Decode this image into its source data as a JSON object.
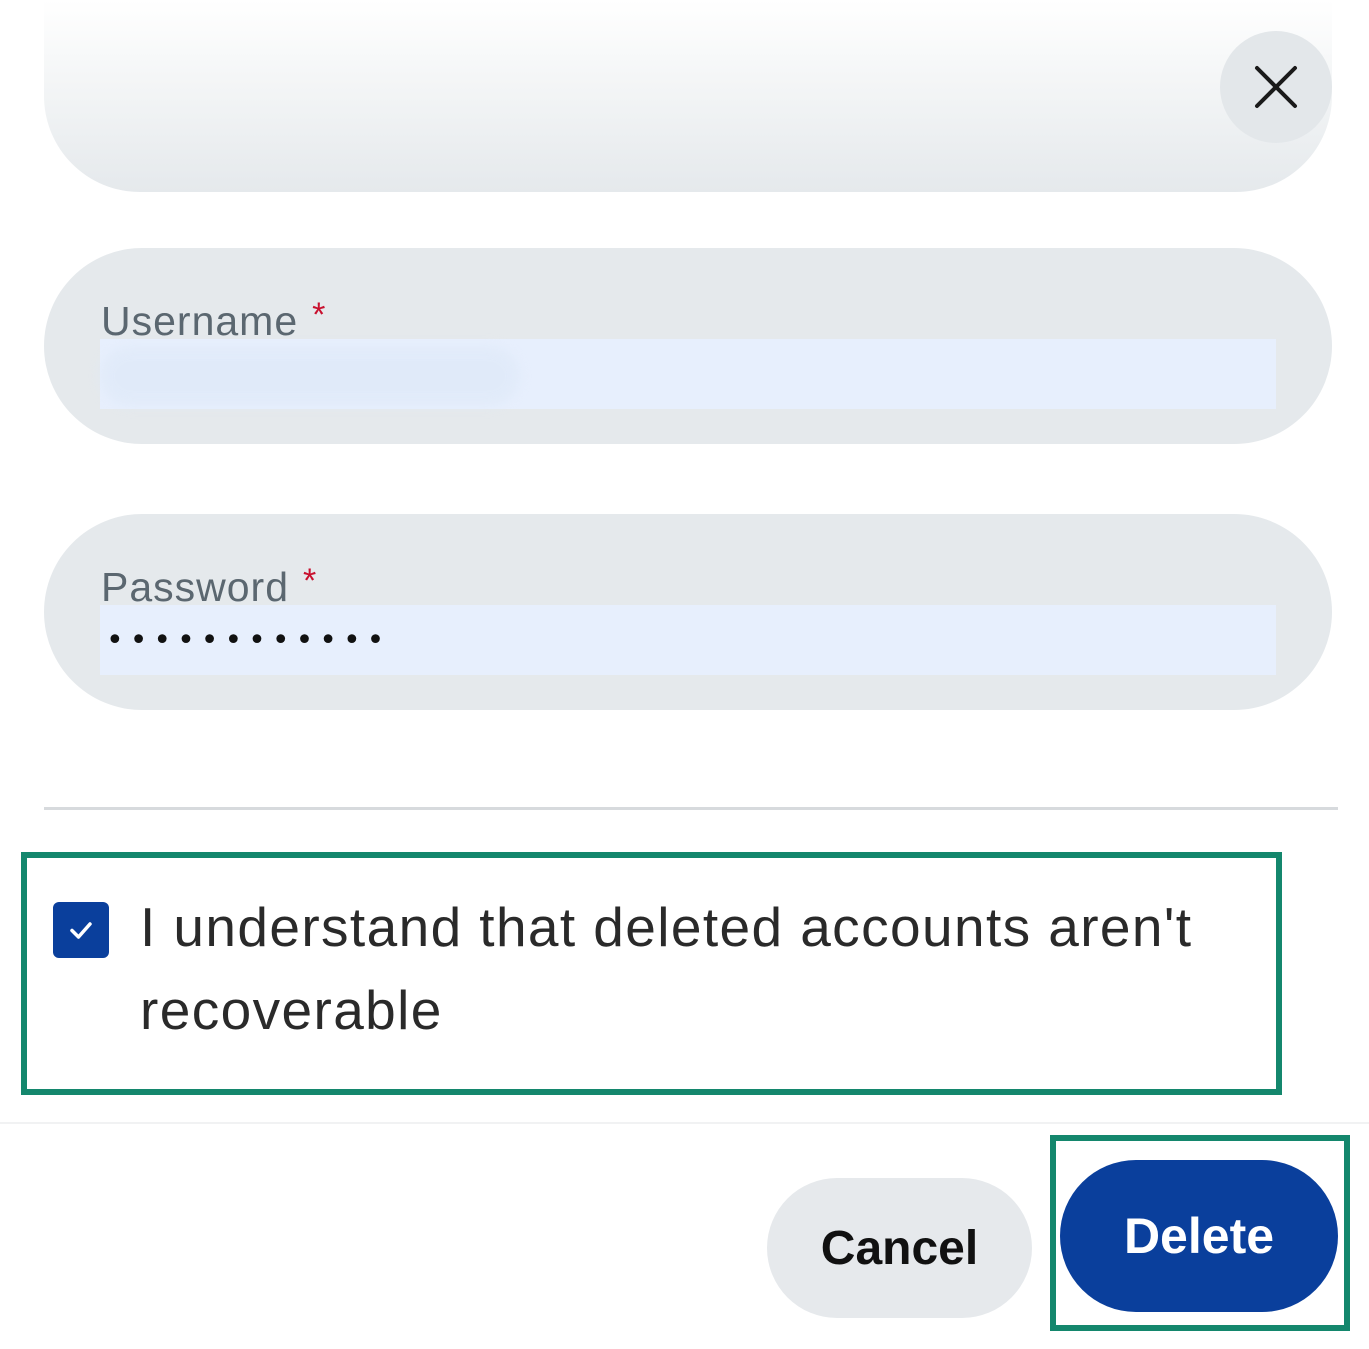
{
  "top_field": {},
  "close": {
    "icon": "close-icon"
  },
  "username": {
    "label": "Username",
    "required_mark": "*",
    "value": ""
  },
  "password": {
    "label": "Password",
    "required_mark": "*",
    "value": "••••••••••••"
  },
  "consent": {
    "checked": true,
    "icon": "checkmark-icon",
    "text": "I understand that deleted accounts aren't recoverable"
  },
  "footer": {
    "cancel_label": "Cancel",
    "delete_label": "Delete"
  },
  "colors": {
    "primary": "#0a3f9c",
    "field_bg": "#e5e9ec",
    "input_autofill_bg": "#e7effd",
    "required": "#c8102e",
    "highlight": "#14876d"
  }
}
